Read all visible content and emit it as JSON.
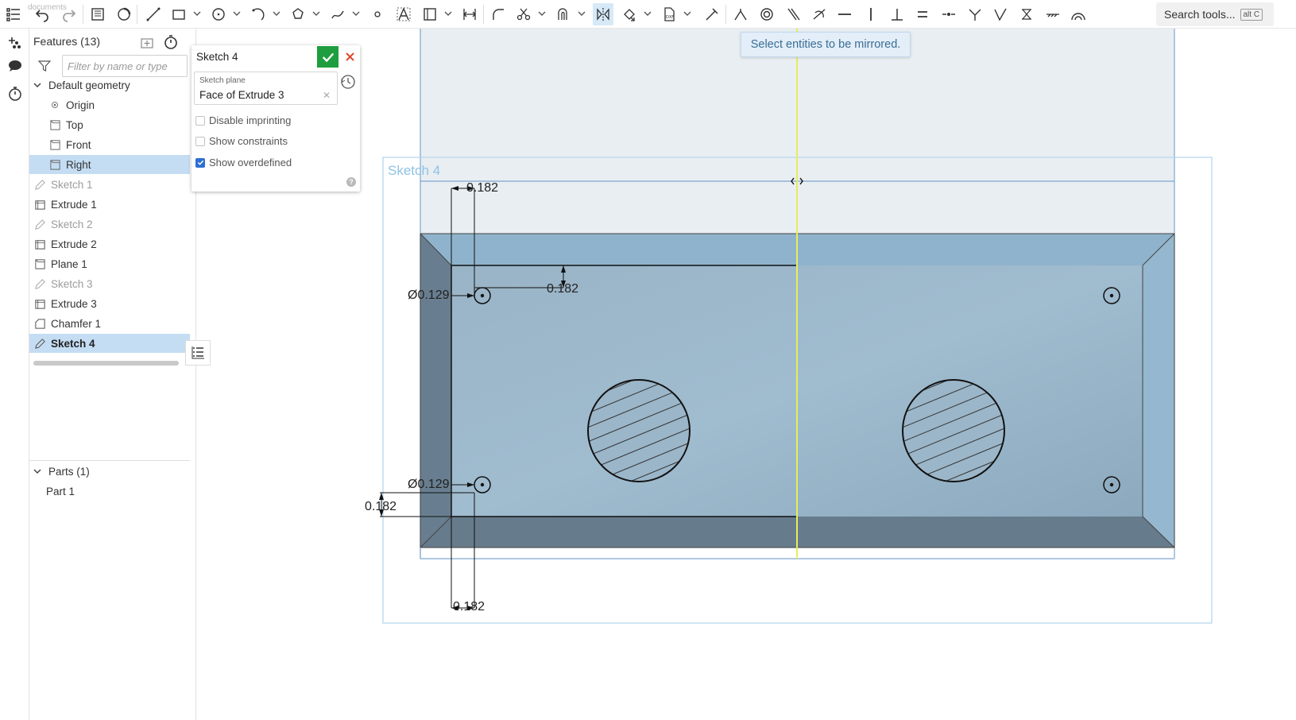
{
  "toolbar": {
    "search_label": "Search tools...",
    "search_shortcut": "alt C",
    "doc_ghost": "documents"
  },
  "features": {
    "header": "Features (13)",
    "filter_placeholder": "Filter by name or type",
    "default_group": "Default geometry",
    "items": [
      {
        "label": "Origin"
      },
      {
        "label": "Top"
      },
      {
        "label": "Front"
      },
      {
        "label": "Right"
      },
      {
        "label": "Sketch 1"
      },
      {
        "label": "Extrude 1"
      },
      {
        "label": "Sketch 2"
      },
      {
        "label": "Extrude 2"
      },
      {
        "label": "Plane 1"
      },
      {
        "label": "Sketch 3"
      },
      {
        "label": "Extrude 3"
      },
      {
        "label": "Chamfer 1"
      },
      {
        "label": "Sketch 4"
      }
    ],
    "parts_group": "Parts (1)",
    "parts": [
      {
        "label": "Part 1"
      }
    ]
  },
  "sketch_dialog": {
    "title": "Sketch 4",
    "plane_label": "Sketch plane",
    "plane_value": "Face of Extrude 3",
    "disable_imprinting": "Disable imprinting",
    "show_constraints": "Show constraints",
    "show_overdefined": "Show overdefined",
    "help": "?"
  },
  "canvas": {
    "tooltip": "Select entities to be mirrored.",
    "sketch_name": "Sketch 4",
    "dimensions": {
      "top_offset": "0.182",
      "hole_top_dia": "Ø0.129",
      "hole_top_offset": "0.182",
      "hole_bottom_dia": "Ø0.129",
      "left_offset": "0.182",
      "bottom_offset": "0.182"
    }
  },
  "colors": {
    "accent": "#1e9e3e",
    "selection": "#c4ddf3",
    "face": "#8fb0c6",
    "mirror_line": "#e6ee5a",
    "sketch_blue": "#8fc3e6"
  }
}
